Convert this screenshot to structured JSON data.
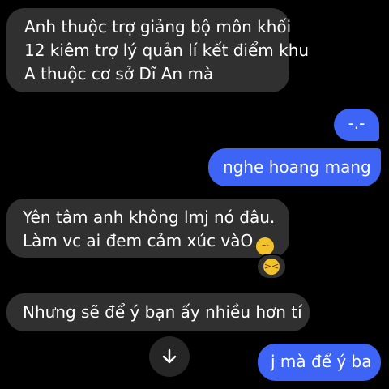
{
  "messages": [
    {
      "id": "msg1",
      "side": "received",
      "lines": [
        "Anh thuộc trợ giảng bộ môn khối",
        "12 kiêm trợ lý quản lí kết điểm khu",
        "A thuộc cơ sở Dĩ An mà"
      ]
    },
    {
      "id": "msg2",
      "side": "sent",
      "text": "-.-"
    },
    {
      "id": "msg3",
      "side": "sent",
      "text": "nghe hoang mang"
    },
    {
      "id": "msg4",
      "side": "received",
      "lines": [
        "Yên tâm anh không lmj nó đâu.",
        "Làm vc ai đem cảm xúc vàO"
      ],
      "emoji": "😮‍💨",
      "reaction": "😆"
    },
    {
      "id": "msg5",
      "side": "received",
      "text": "Nhưng sẽ để ý bạn ấy nhiều hơn tí"
    },
    {
      "id": "msg6",
      "side": "sent",
      "text": "j mà để ý ba"
    }
  ],
  "icons": {
    "emoji_inline": "sneeze-face-icon",
    "reaction": "grinning-squinting-face-icon",
    "scroll": "arrow-down-icon"
  },
  "colors": {
    "background": "#000000",
    "received_bubble": "#303030",
    "sent_bubble": "#3d64f5",
    "text": "#ffffff"
  }
}
